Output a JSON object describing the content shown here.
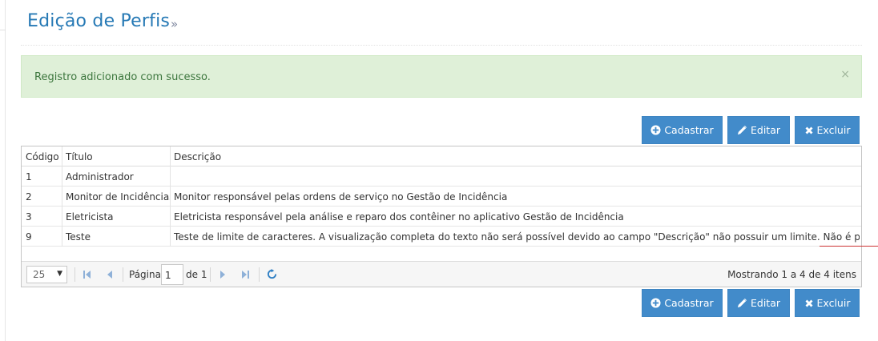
{
  "header": {
    "title": "Edição de Perfis",
    "arrow": "»"
  },
  "alert": {
    "message": "Registro adicionado com sucesso.",
    "close": "×"
  },
  "toolbar": {
    "cadastrar_label": "Cadastrar",
    "editar_label": "Editar",
    "excluir_label": "Excluir",
    "colors": {
      "primary": "#428bca"
    }
  },
  "grid": {
    "columns": [
      "Código",
      "Título",
      "Descrição"
    ],
    "rows": [
      {
        "codigo": "1",
        "titulo": "Administrador",
        "descricao": ""
      },
      {
        "codigo": "2",
        "titulo": "Monitor de Incidências",
        "descricao": "Monitor responsável pelas ordens de serviço no Gestão de Incidência"
      },
      {
        "codigo": "3",
        "titulo": "Eletricista",
        "descricao": "Eletricista responsável pela análise e reparo dos contêiner no aplicativo Gestão de Incidência"
      },
      {
        "codigo": "9",
        "titulo": "Teste",
        "descricao": "Teste de limite de caracteres. A visualização completa do texto não será possível devido ao campo \"Descrição\" não possuir um limite. Não é possível usar"
      }
    ]
  },
  "pager": {
    "page_size": "25",
    "page_label": "Página",
    "page_value": "1",
    "of_label": "de 1",
    "info": "Mostrando 1 a 4 de 4 itens"
  }
}
